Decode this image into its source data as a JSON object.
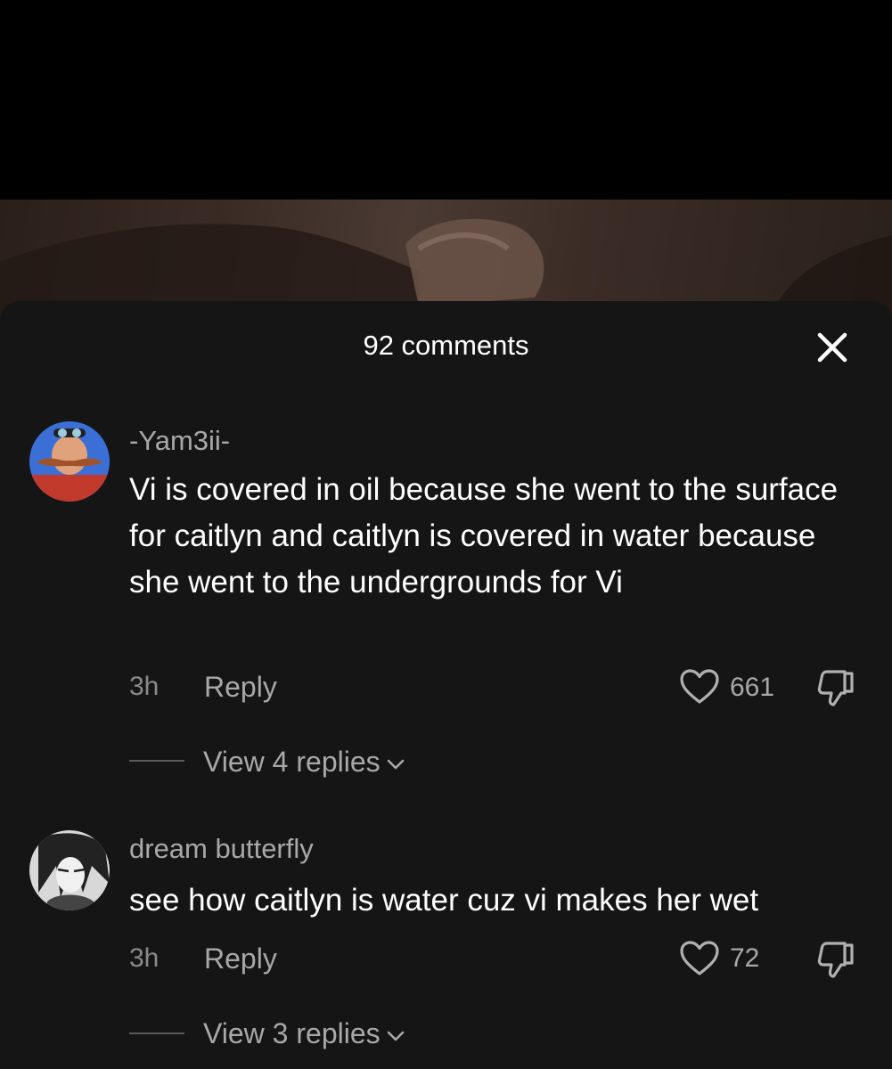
{
  "header": {
    "title": "92 comments"
  },
  "comments": [
    {
      "username": "-Yam3ii-",
      "text": "Vi is covered in oil because she went to the surface for caitlyn and caitlyn is covered in water because she went to the undergrounds for Vi",
      "time": "3h",
      "reply_label": "Reply",
      "likes": "661",
      "view_replies": "View 4 replies"
    },
    {
      "username": "dream butterfly",
      "text": "see how caitlyn is water cuz vi makes her wet",
      "time": "3h",
      "reply_label": "Reply",
      "likes": "72",
      "view_replies": "View 3 replies"
    }
  ],
  "icons": {
    "close": "close-icon",
    "like": "heart-outline-icon",
    "dislike": "thumbs-down-icon",
    "expand": "chevron-down-icon"
  },
  "colors": {
    "sheet_background": "#151515",
    "primary_text": "#ffffff",
    "secondary_text": "#a8a8a8"
  }
}
